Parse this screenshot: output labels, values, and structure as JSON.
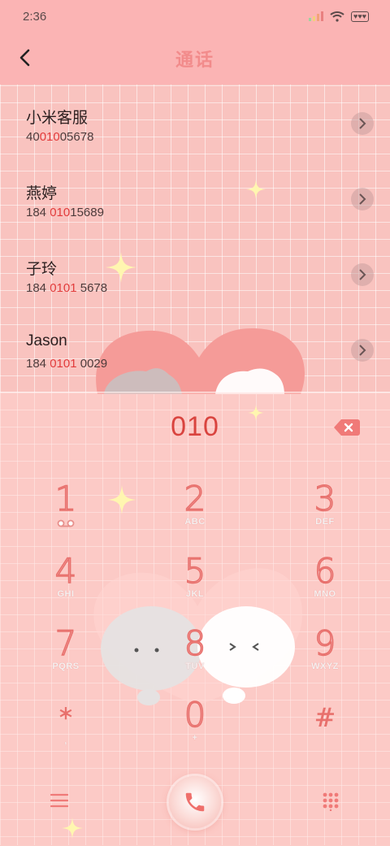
{
  "status": {
    "time": "2:36"
  },
  "header": {
    "title": "通话"
  },
  "contacts": [
    {
      "name": "小米客服",
      "num_pre": "40",
      "num_hl": "010",
      "num_post": "05678"
    },
    {
      "name": "燕婷",
      "num_pre": "184 ",
      "num_hl": "010",
      "num_post": "15689"
    },
    {
      "name": "子玲",
      "num_pre": "184 ",
      "num_hl": "0101",
      "num_post": " 5678"
    },
    {
      "name": "Jason",
      "num_pre": "184 ",
      "num_hl": "0101",
      "num_post": " 0029"
    }
  ],
  "dialer": {
    "input": "010",
    "keys": [
      {
        "digit": "1",
        "letters": ""
      },
      {
        "digit": "2",
        "letters": "ABC"
      },
      {
        "digit": "3",
        "letters": "DEF"
      },
      {
        "digit": "4",
        "letters": "GHI"
      },
      {
        "digit": "5",
        "letters": "JKL"
      },
      {
        "digit": "6",
        "letters": "MNO"
      },
      {
        "digit": "7",
        "letters": "PQRS"
      },
      {
        "digit": "8",
        "letters": "TUV"
      },
      {
        "digit": "9",
        "letters": "WXYZ"
      },
      {
        "digit": "*",
        "letters": ","
      },
      {
        "digit": "0",
        "letters": "+"
      },
      {
        "digit": "#",
        "letters": ""
      }
    ]
  },
  "colors": {
    "accent": "#e23b3b",
    "header_bg": "#fbb4b4",
    "title": "#f28b8b"
  },
  "icons": {
    "back": "chevron-left-icon",
    "call": "phone-icon",
    "menu": "menu-icon",
    "keypad": "keypad-icon",
    "voicemail": "voicemail-icon",
    "backspace": "backspace-icon"
  }
}
